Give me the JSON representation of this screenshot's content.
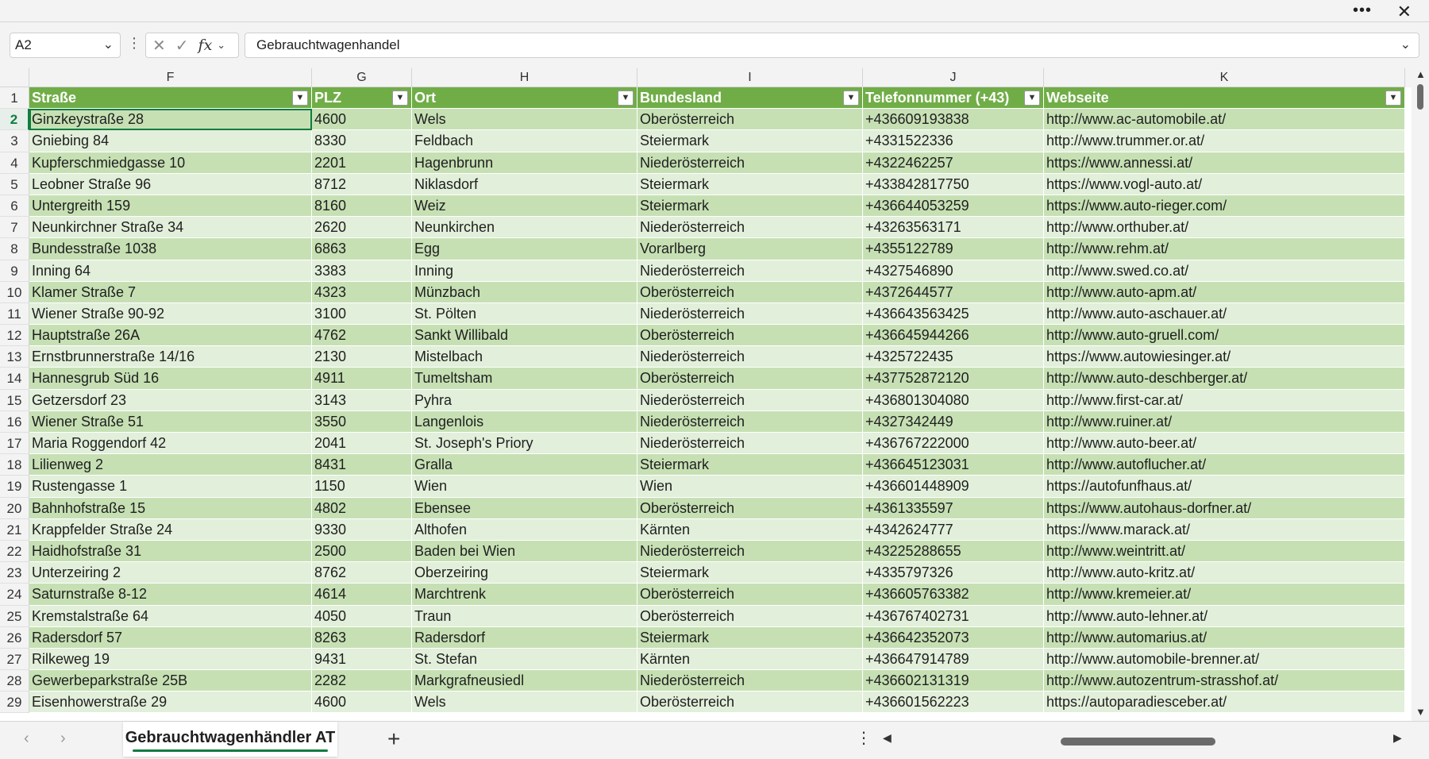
{
  "window": {
    "more_icon": "more-icon",
    "close_icon": "close-icon"
  },
  "formula_bar": {
    "name_box": "A2",
    "formula": "Gebrauchtwagenhandel"
  },
  "columns": [
    "F",
    "G",
    "H",
    "I",
    "J",
    "K"
  ],
  "table": {
    "headers": [
      "Straße",
      "PLZ",
      "Ort",
      "Bundesland",
      "Telefonnummer (+43)",
      "Webseite"
    ],
    "header_color": "#70ad47",
    "band_colors": [
      "#c6e0b4",
      "#e2efda"
    ],
    "rows": [
      {
        "n": "2",
        "cells": [
          "Ginzkeystraße 28",
          "4600",
          "Wels",
          "Oberösterreich",
          "+436609193838",
          "http://www.ac-automobile.at/"
        ]
      },
      {
        "n": "3",
        "cells": [
          "Gniebing 84",
          "8330",
          "Feldbach",
          "Steiermark",
          "+4331522336",
          "http://www.trummer.or.at/"
        ]
      },
      {
        "n": "4",
        "cells": [
          "Kupferschmiedgasse 10",
          "2201",
          "Hagenbrunn",
          "Niederösterreich",
          "+4322462257",
          "https://www.annessi.at/"
        ]
      },
      {
        "n": "5",
        "cells": [
          "Leobner Straße 96",
          "8712",
          "Niklasdorf",
          "Steiermark",
          "+433842817750",
          "https://www.vogl-auto.at/"
        ]
      },
      {
        "n": "6",
        "cells": [
          "Untergreith 159",
          "8160",
          "Weiz",
          "Steiermark",
          "+436644053259",
          "https://www.auto-rieger.com/"
        ]
      },
      {
        "n": "7",
        "cells": [
          "Neunkirchner Straße 34",
          "2620",
          "Neunkirchen",
          "Niederösterreich",
          "+43263563171",
          "http://www.orthuber.at/"
        ]
      },
      {
        "n": "8",
        "cells": [
          "Bundesstraße 1038",
          "6863",
          "Egg",
          "Vorarlberg",
          "+4355122789",
          "http://www.rehm.at/"
        ]
      },
      {
        "n": "9",
        "cells": [
          "Inning 64",
          "3383",
          "Inning",
          "Niederösterreich",
          "+4327546890",
          "http://www.swed.co.at/"
        ]
      },
      {
        "n": "10",
        "cells": [
          "Klamer Straße 7",
          "4323",
          "Münzbach",
          "Oberösterreich",
          "+4372644577",
          "http://www.auto-apm.at/"
        ]
      },
      {
        "n": "11",
        "cells": [
          "Wiener Straße 90-92",
          "3100",
          "St. Pölten",
          "Niederösterreich",
          "+436643563425",
          "http://www.auto-aschauer.at/"
        ]
      },
      {
        "n": "12",
        "cells": [
          "Hauptstraße 26A",
          "4762",
          "Sankt Willibald",
          "Oberösterreich",
          "+436645944266",
          "http://www.auto-gruell.com/"
        ]
      },
      {
        "n": "13",
        "cells": [
          "Ernstbrunnerstraße 14/16",
          "2130",
          "Mistelbach",
          "Niederösterreich",
          "+4325722435",
          "https://www.autowiesinger.at/"
        ]
      },
      {
        "n": "14",
        "cells": [
          "Hannesgrub Süd 16",
          "4911",
          "Tumeltsham",
          "Oberösterreich",
          "+437752872120",
          "http://www.auto-deschberger.at/"
        ]
      },
      {
        "n": "15",
        "cells": [
          "Getzersdorf 23",
          "3143",
          "Pyhra",
          "Niederösterreich",
          "+436801304080",
          "http://www.first-car.at/"
        ]
      },
      {
        "n": "16",
        "cells": [
          "Wiener Straße 51",
          "3550",
          "Langenlois",
          "Niederösterreich",
          "+4327342449",
          "http://www.ruiner.at/"
        ]
      },
      {
        "n": "17",
        "cells": [
          "Maria Roggendorf 42",
          "2041",
          "St. Joseph's Priory",
          "Niederösterreich",
          "+436767222000",
          "http://www.auto-beer.at/"
        ]
      },
      {
        "n": "18",
        "cells": [
          "Lilienweg 2",
          "8431",
          "Gralla",
          "Steiermark",
          "+436645123031",
          "http://www.autoflucher.at/"
        ]
      },
      {
        "n": "19",
        "cells": [
          "Rustengasse 1",
          "1150",
          "Wien",
          "Wien",
          "+436601448909",
          "https://autofunfhaus.at/"
        ]
      },
      {
        "n": "20",
        "cells": [
          "Bahnhofstraße 15",
          "4802",
          "Ebensee",
          "Oberösterreich",
          "+4361335597",
          "https://www.autohaus-dorfner.at/"
        ]
      },
      {
        "n": "21",
        "cells": [
          "Krappfelder Straße 24",
          "9330",
          "Althofen",
          "Kärnten",
          "+4342624777",
          "https://www.marack.at/"
        ]
      },
      {
        "n": "22",
        "cells": [
          "Haidhofstraße 31",
          "2500",
          "Baden bei Wien",
          "Niederösterreich",
          "+43225288655",
          "http://www.weintritt.at/"
        ]
      },
      {
        "n": "23",
        "cells": [
          "Unterzeiring 2",
          "8762",
          "Oberzeiring",
          "Steiermark",
          "+4335797326",
          "http://www.auto-kritz.at/"
        ]
      },
      {
        "n": "24",
        "cells": [
          "Saturnstraße 8-12",
          "4614",
          "Marchtrenk",
          "Oberösterreich",
          "+436605763382",
          "http://www.kremeier.at/"
        ]
      },
      {
        "n": "25",
        "cells": [
          "Kremstalstraße 64",
          "4050",
          "Traun",
          "Oberösterreich",
          "+436767402731",
          "http://www.auto-lehner.at/"
        ]
      },
      {
        "n": "26",
        "cells": [
          "Radersdorf 57",
          "8263",
          "Radersdorf",
          "Steiermark",
          "+436642352073",
          "http://www.automarius.at/"
        ]
      },
      {
        "n": "27",
        "cells": [
          "Rilkeweg 19",
          "9431",
          "St. Stefan",
          "Kärnten",
          "+436647914789",
          "http://www.automobile-brenner.at/"
        ]
      },
      {
        "n": "28",
        "cells": [
          "Gewerbeparkstraße 25B",
          "2282",
          "Markgrafneusiedl",
          "Niederösterreich",
          "+436602131319",
          "http://www.autozentrum-strasshof.at/"
        ]
      },
      {
        "n": "29",
        "cells": [
          "Eisenhowerstraße 29",
          "4600",
          "Wels",
          "Oberösterreich",
          "+436601562223",
          "https://autoparadiesceber.at/"
        ]
      }
    ]
  },
  "sheet_tabs": {
    "active": "Gebrauchtwagenhändler AT",
    "add_icon": "plus-icon"
  },
  "accent_color": "#107c41"
}
